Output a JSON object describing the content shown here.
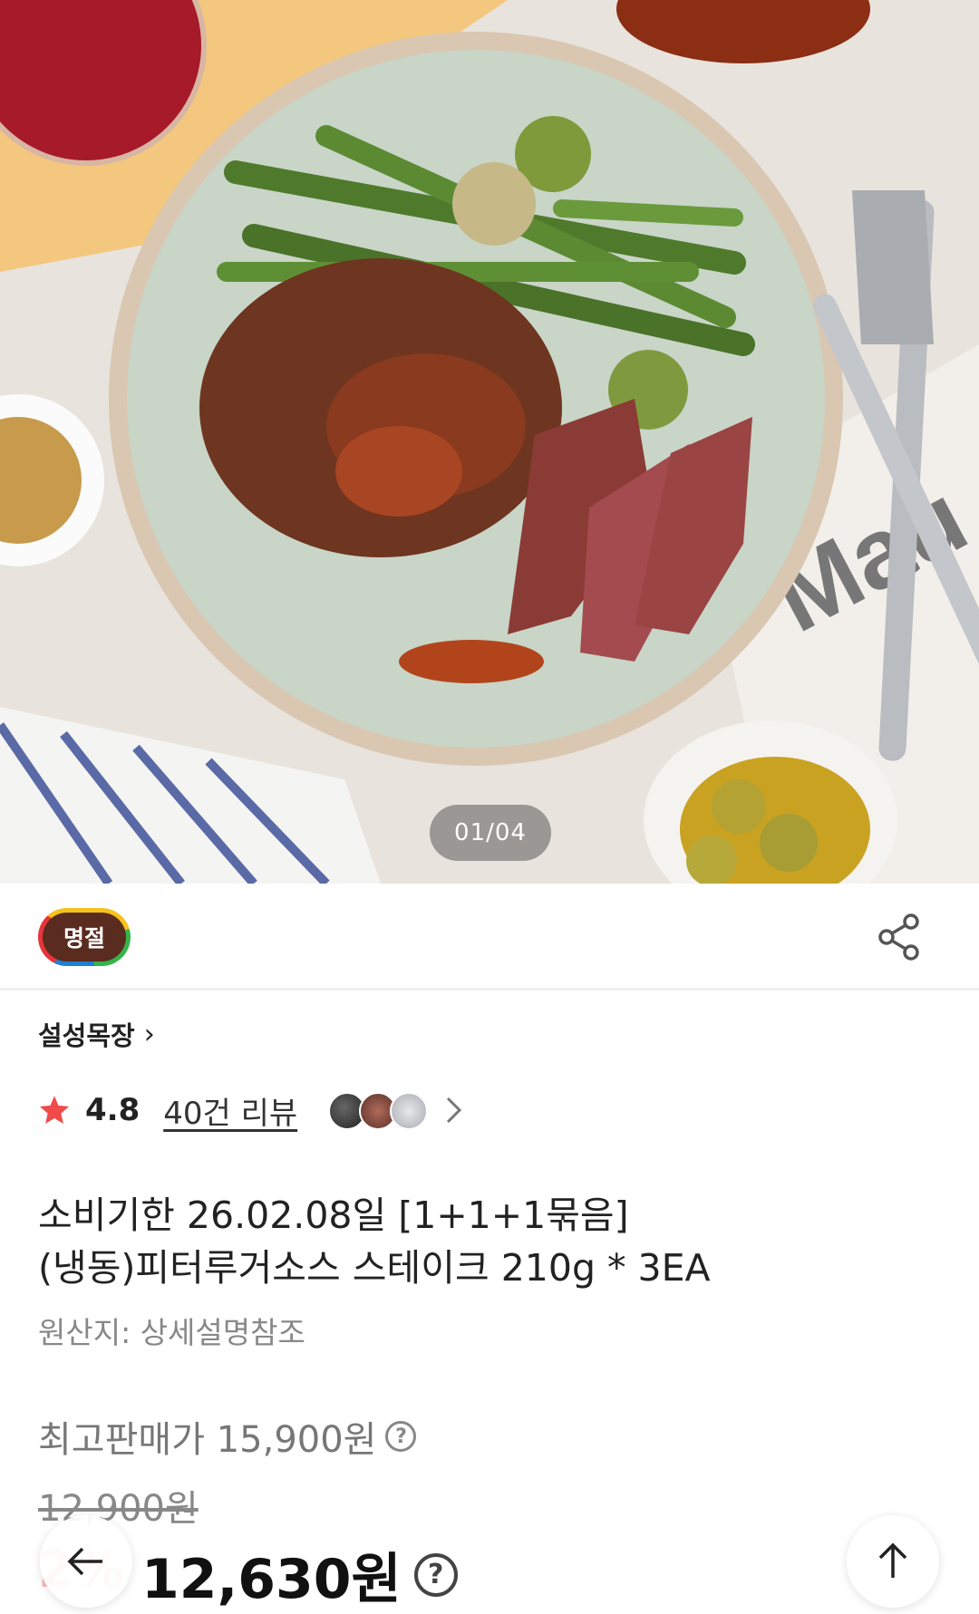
{
  "gallery": {
    "counter": "01/04"
  },
  "badge": {
    "label": "명절",
    "colors": [
      "#f6c21b",
      "#35b44a",
      "#1f7fd1",
      "#e7353b"
    ],
    "fill": "#5a2b1f"
  },
  "share": {
    "icon": "share-icon"
  },
  "seller": {
    "name": "설성목장",
    "chevron": "›"
  },
  "rating": {
    "score": "4.8",
    "reviews_label": "40건 리뷰",
    "icon": "star-icon",
    "star_color": "#f04a4a"
  },
  "product": {
    "title_line1": "소비기한 26.02.08일 [1+1+1묶음]",
    "title_line2": "(냉동)피터루거소스 스테이크 210g * 3EA",
    "origin": "원산지: 상세설명참조"
  },
  "price": {
    "top_label": "최고판매가 15,900원",
    "original": "12,900원",
    "discount_partial": "2%",
    "final": "12,630원"
  },
  "floating": {
    "back_icon": "arrow-left-icon",
    "top_icon": "arrow-up-icon"
  }
}
